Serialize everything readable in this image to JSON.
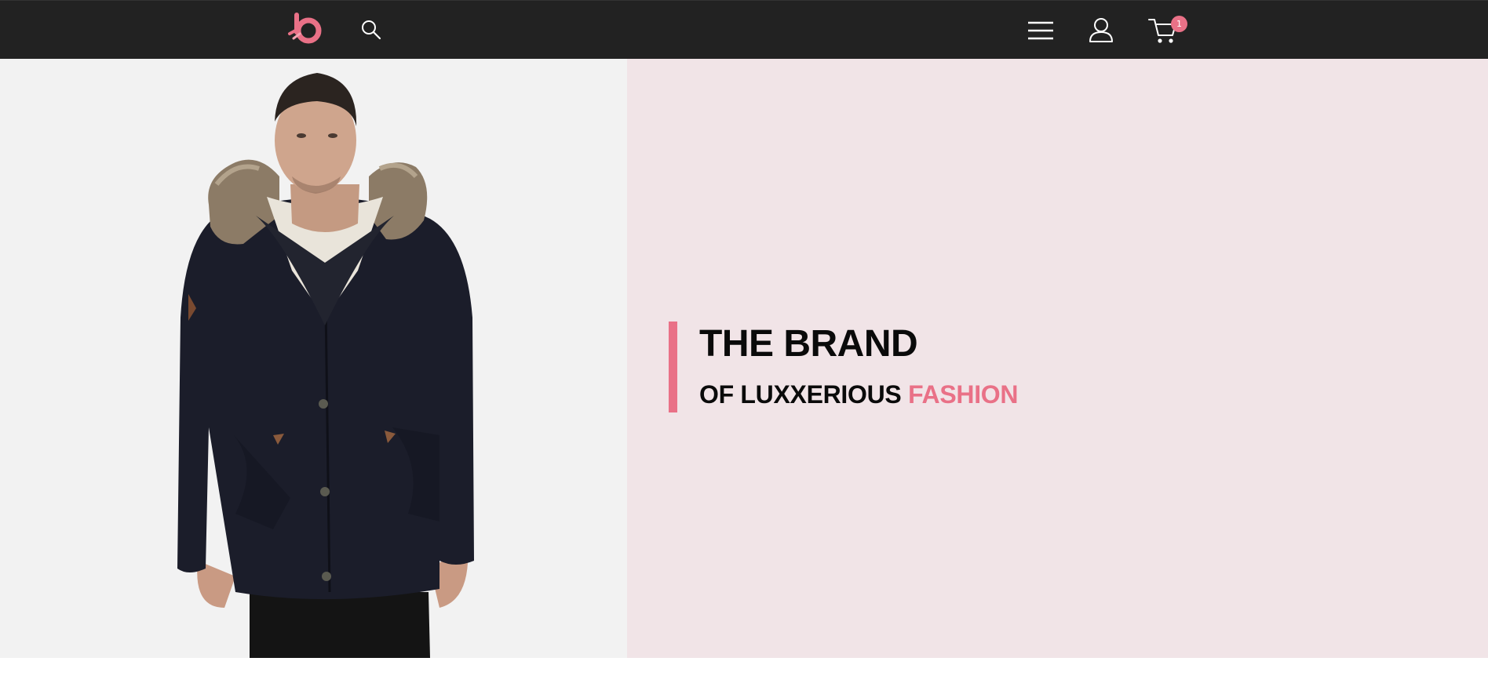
{
  "header": {
    "cart_count": "1",
    "icons": [
      "logo-icon",
      "search-icon",
      "menu-icon",
      "user-icon",
      "cart-icon"
    ]
  },
  "hero": {
    "headline": "THE BRAND",
    "subline_prefix": "OF LUXXERIOUS",
    "subline_accent": "FASHION"
  },
  "colors": {
    "accent": "#e97187",
    "topbar": "#222222",
    "hero_left_bg": "#f2f2f2",
    "hero_right_bg": "#f1e4e7"
  }
}
